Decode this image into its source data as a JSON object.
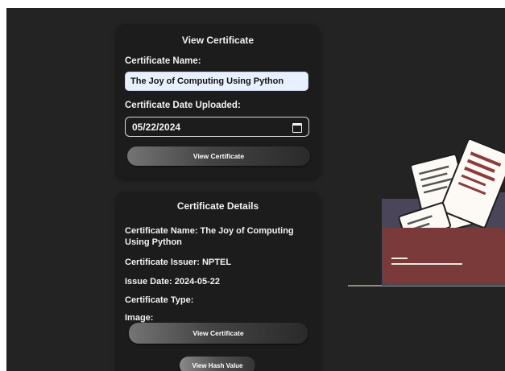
{
  "view_card": {
    "title": "View Certificate",
    "name_label": "Certificate Name:",
    "name_value": "The Joy of Computing Using Python",
    "date_label": "Certificate Date Uploaded:",
    "date_value": "05/22/2024",
    "button_label": "View Certificate"
  },
  "details_card": {
    "title": "Certificate Details",
    "name_line": "Certificate Name: The Joy of Computing Using Python",
    "issuer_line": "Certificate Issuer: NPTEL",
    "issue_date_line": "Issue Date: 2024-05-22",
    "type_line": "Certificate Type:",
    "image_label": "Image:",
    "view_button_label": "View Certificate",
    "hash_button_label": "View Hash Value"
  },
  "icons": {
    "calendar": "calendar-icon",
    "illustration": "folder-documents-illustration"
  },
  "colors": {
    "background": "#232323",
    "card": "#1c1c1c",
    "input_fill": "#e8f0fe",
    "folder_back": "#4a4558",
    "folder_front": "#7a3a3a",
    "document_stripe": "#8b3d3d"
  }
}
